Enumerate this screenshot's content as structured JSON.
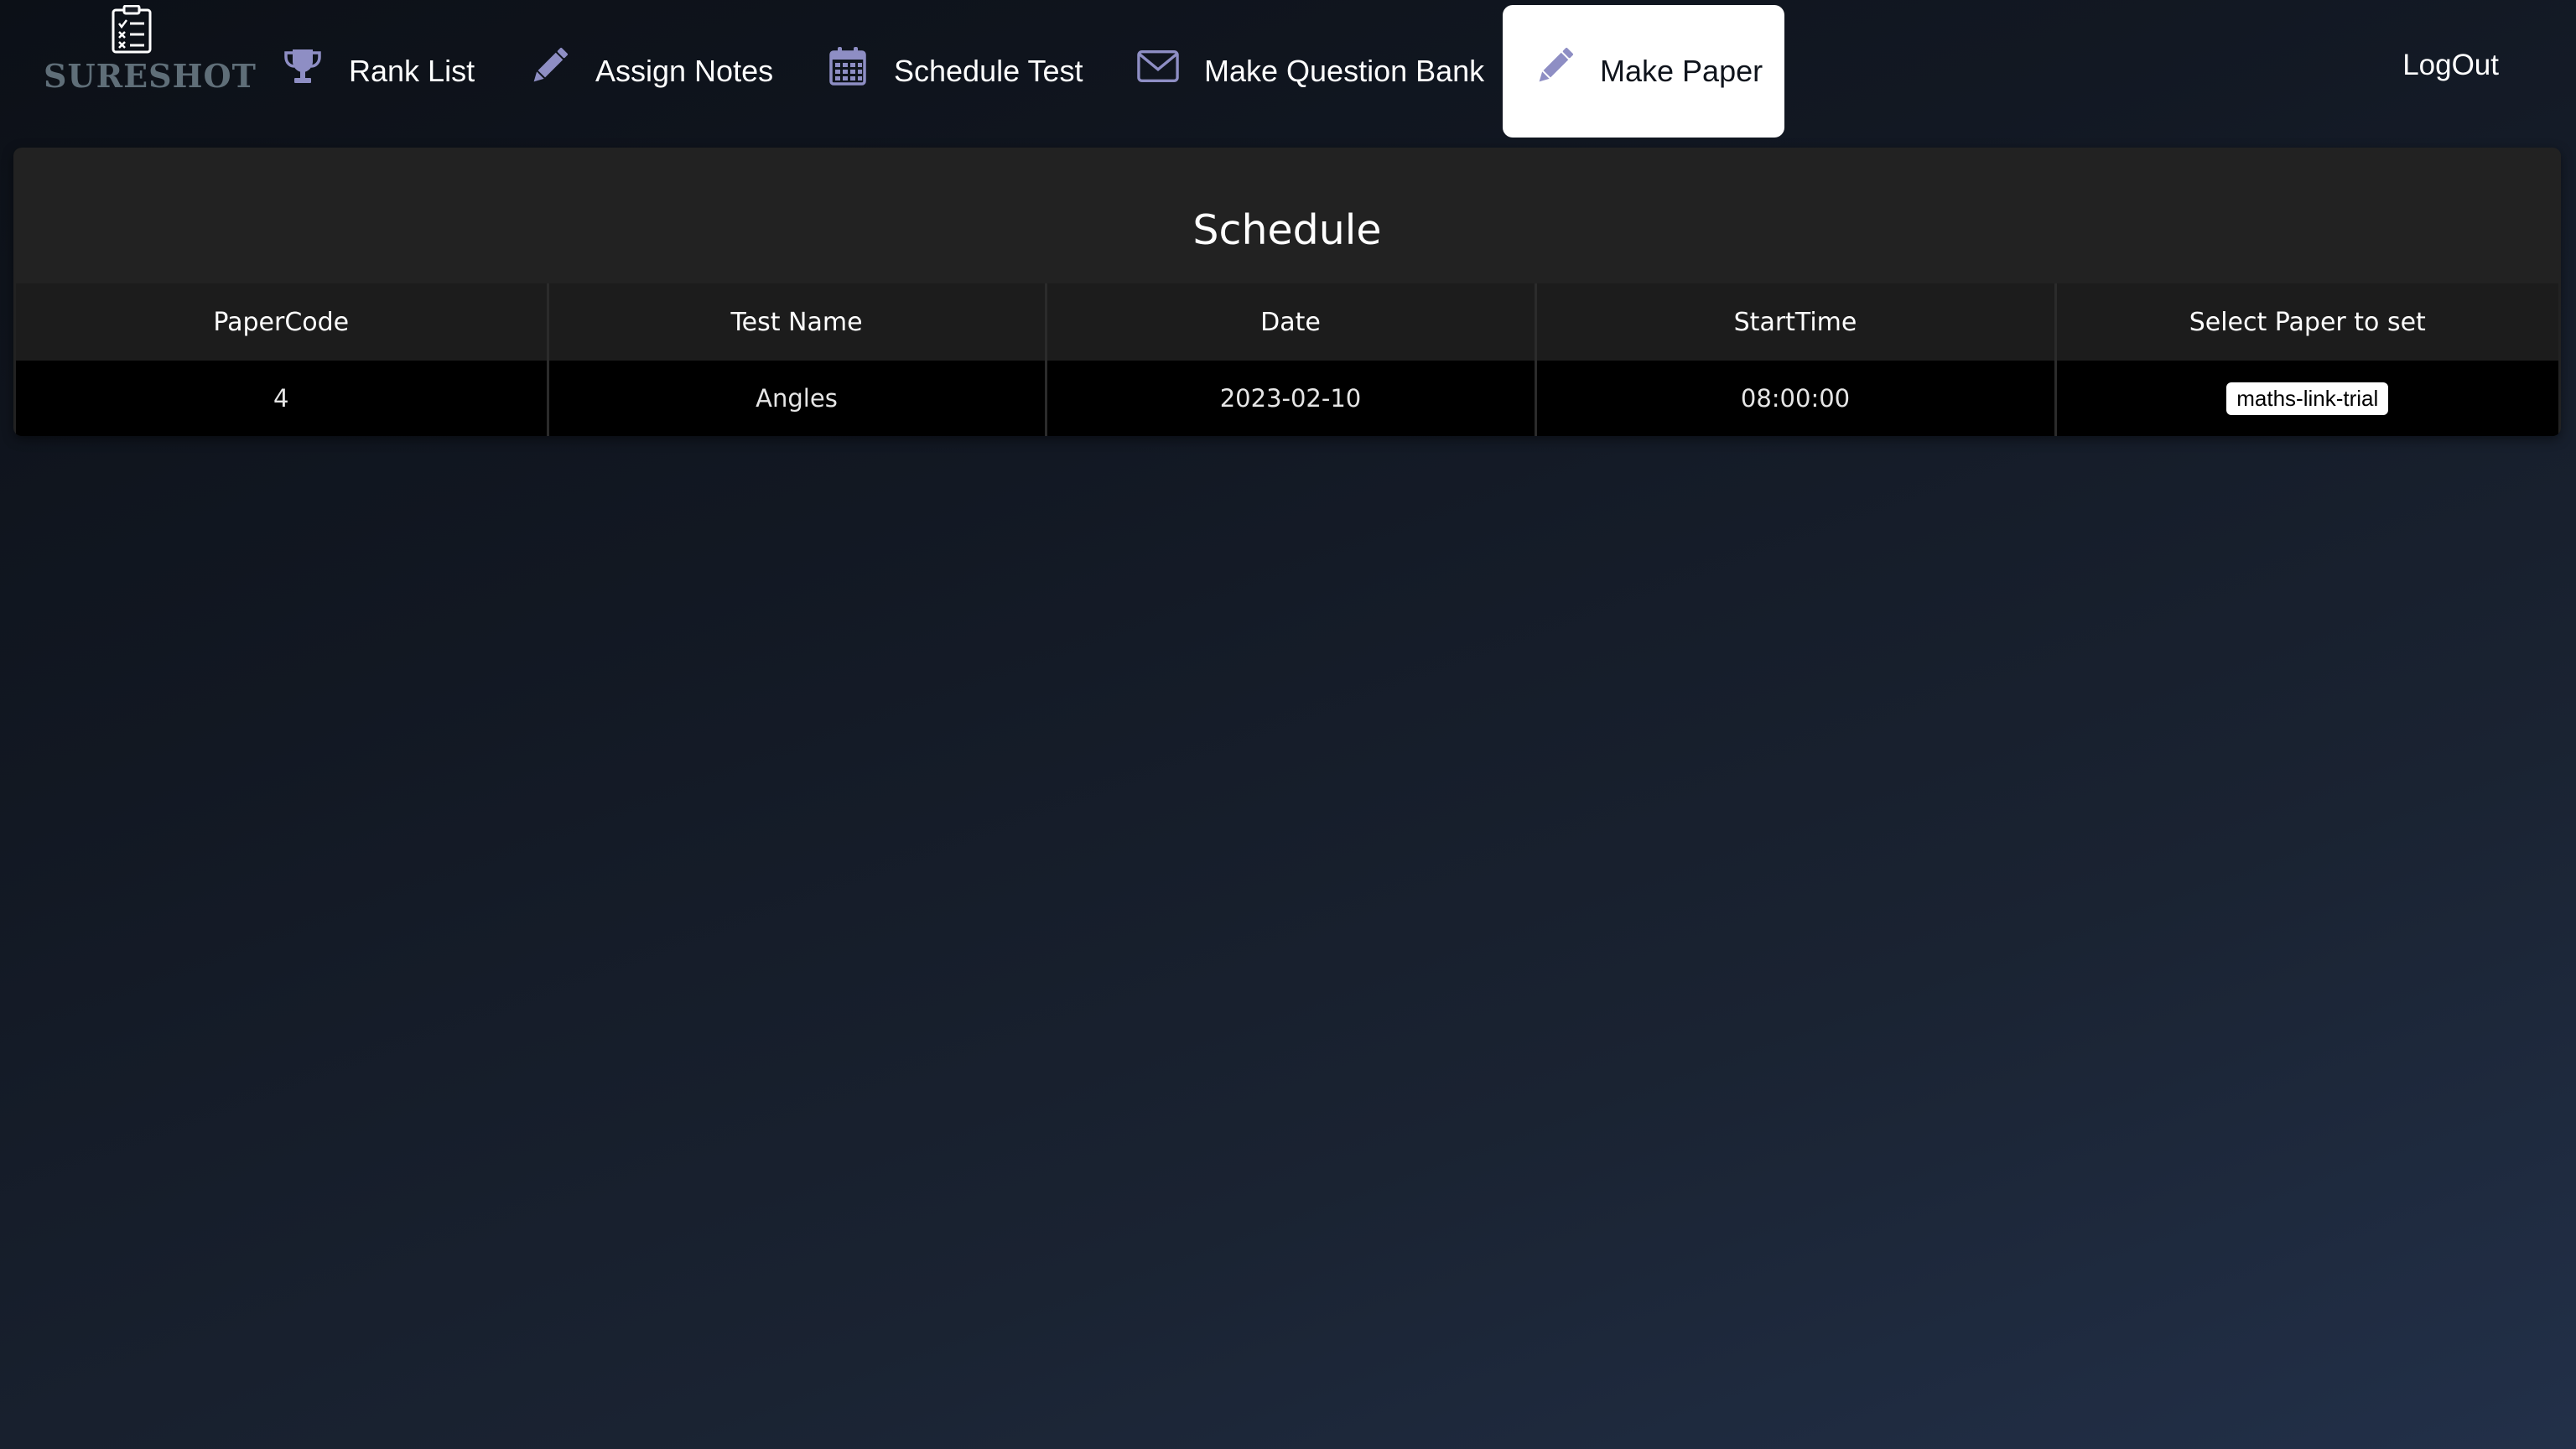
{
  "brand": {
    "name": "SURESHOT",
    "icon": "clipboard-checklist-icon"
  },
  "nav": {
    "items": [
      {
        "label": "Rank List",
        "icon": "trophy-icon"
      },
      {
        "label": "Assign Notes",
        "icon": "pencil-icon"
      },
      {
        "label": "Schedule Test",
        "icon": "calendar-icon"
      },
      {
        "label": "Make Question Bank",
        "icon": "envelope-icon"
      },
      {
        "label": "Make Paper",
        "icon": "pencil-icon",
        "active": true
      }
    ],
    "logout": "LogOut"
  },
  "schedule": {
    "title": "Schedule",
    "columns": [
      "PaperCode",
      "Test Name",
      "Date",
      "StartTime",
      "Select Paper to set"
    ],
    "rows": [
      {
        "paper_code": "4",
        "test_name": "Angles",
        "date": "2023-02-10",
        "start_time": "08:00:00",
        "paper": "maths-link-trial"
      }
    ]
  },
  "colors": {
    "background_start": "#0c1017",
    "background_end": "#223049",
    "panel": "#222222",
    "icon": "#8e8ec4",
    "active_tab": "#ffffff"
  }
}
